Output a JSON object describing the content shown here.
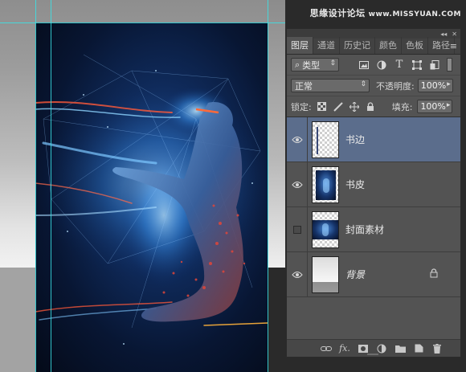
{
  "watermark": {
    "main": "思缘设计论坛",
    "site": "www.MISSYUAN.COM"
  },
  "panel": {
    "header_buttons": [
      "◂◂",
      "✕"
    ],
    "tabs": [
      {
        "label": "图层",
        "active": true
      },
      {
        "label": "通道",
        "active": false
      },
      {
        "label": "历史记",
        "active": false
      },
      {
        "label": "颜色",
        "active": false
      },
      {
        "label": "色板",
        "active": false
      },
      {
        "label": "路径",
        "active": false
      }
    ],
    "menu_icon": "panel-menu-icon",
    "filter": {
      "label": "类型",
      "icons": [
        "image-filter-icon",
        "adjustment-filter-icon",
        "type-filter-icon",
        "shape-filter-icon",
        "smart-object-filter-icon"
      ]
    },
    "blend_mode": "正常",
    "opacity_label": "不透明度:",
    "opacity_value": "100%",
    "lock_label": "锁定:",
    "fill_label": "填充:",
    "fill_value": "100%",
    "layers": [
      {
        "name": "书边",
        "visible": true,
        "selected": true,
        "thumb": "stroke"
      },
      {
        "name": "书皮",
        "visible": true,
        "selected": false,
        "thumb": "artwork"
      },
      {
        "name": "封面素材",
        "visible": false,
        "selected": false,
        "thumb": "artwork"
      },
      {
        "name": "背景",
        "visible": true,
        "selected": false,
        "thumb": "gradient",
        "locked": true,
        "italic": true
      }
    ],
    "bottom_icons": [
      "link-icon",
      "fx-icon",
      "mask-icon",
      "adjustment-icon",
      "folder-icon",
      "new-layer-icon",
      "trash-icon"
    ],
    "fx_label": "fx."
  },
  "colors": {
    "guide": "#39e3e6",
    "selection": "#5b6d8c",
    "panel": "#535353"
  }
}
